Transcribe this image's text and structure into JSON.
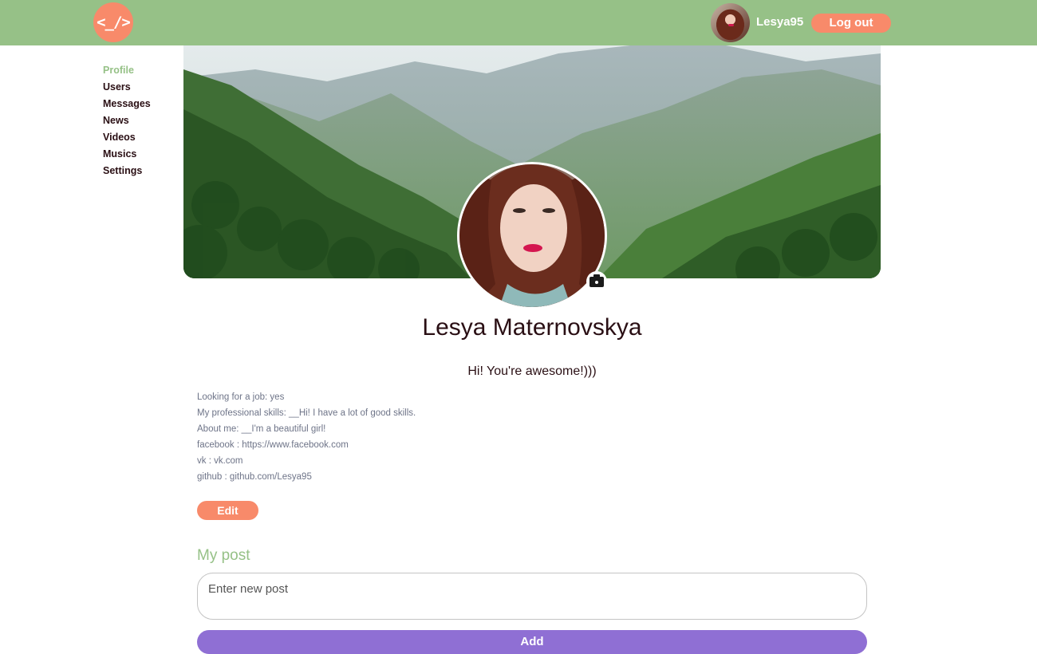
{
  "header": {
    "logo_text": "<_/>",
    "username": "Lesya95",
    "logout_label": "Log out"
  },
  "sidebar": {
    "items": [
      {
        "label": "Profile",
        "active": true
      },
      {
        "label": "Users",
        "active": false
      },
      {
        "label": "Messages",
        "active": false
      },
      {
        "label": "News",
        "active": false
      },
      {
        "label": "Videos",
        "active": false
      },
      {
        "label": "Musics",
        "active": false
      },
      {
        "label": "Settings",
        "active": false
      }
    ]
  },
  "profile": {
    "full_name": "Lesya Maternovskya",
    "status": "Hi! You're awesome!)))",
    "info": [
      "Looking for a job: yes",
      "My professional skills: __Hi! I have a lot of good skills.",
      "About me: __I'm a beautiful girl!",
      "facebook : https://www.facebook.com",
      "vk : vk.com",
      "github : github.com/Lesya95"
    ],
    "edit_label": "Edit"
  },
  "posts": {
    "title": "My post",
    "input_placeholder": "Enter new post",
    "add_label": "Add"
  },
  "colors": {
    "header_bg": "#96c187",
    "accent": "#f88a6a",
    "add_button": "#8f6fd4",
    "text_dark": "#2a0f14",
    "info_text": "#6e7488"
  }
}
